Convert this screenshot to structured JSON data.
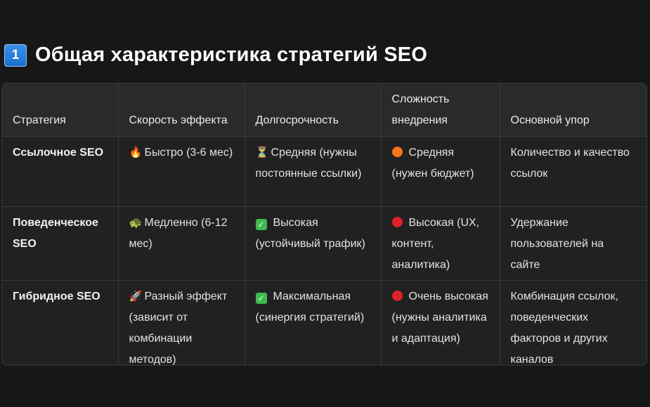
{
  "section": {
    "number": "1",
    "title": "Общая характеристика стратегий SEO"
  },
  "table": {
    "headers": [
      "Стратегия",
      "Скорость эффекта",
      "Долгосрочность",
      "Сложность внедрения",
      "Основной упор"
    ],
    "rows": [
      {
        "strategy": "Ссылочное SEO",
        "speed": {
          "icon": "🔥",
          "text": "Быстро (3-6 мес)"
        },
        "longevity": {
          "icon": "⏳",
          "text": "Средняя (нужны постоянные ссылки)"
        },
        "complexity": {
          "icon": "orange-circle",
          "text": "Средняя (нужен бюджет)"
        },
        "focus": "Количество и качество ссылок"
      },
      {
        "strategy": "Поведенческое SEO",
        "speed": {
          "icon": "🐢",
          "text": "Медленно (6-12 мес)"
        },
        "longevity": {
          "icon": "check-mark-button",
          "text": "Высокая (устойчивый трафик)"
        },
        "complexity": {
          "icon": "red-circle",
          "text": "Высокая (UX, контент, аналитика)"
        },
        "focus": "Удержание пользователей на сайте"
      },
      {
        "strategy": "Гибридное SEO",
        "speed": {
          "icon": "🚀",
          "text": "Разный эффект (зависит от комбинации методов)"
        },
        "longevity": {
          "icon": "check-mark-button",
          "text": "Максимальная (синергия стратегий)"
        },
        "complexity": {
          "icon": "red-circle",
          "text": "Очень высокая (нужны аналитика и адаптация)"
        },
        "focus": "Комбинация ссылок, поведенческих факторов и других каналов"
      }
    ]
  },
  "colors": {
    "background": "#171717",
    "table_bg": "#212121",
    "header_bg": "#2a2a2a",
    "orange": "#f5761a",
    "red": "#e0202b",
    "green": "#3fb950"
  }
}
